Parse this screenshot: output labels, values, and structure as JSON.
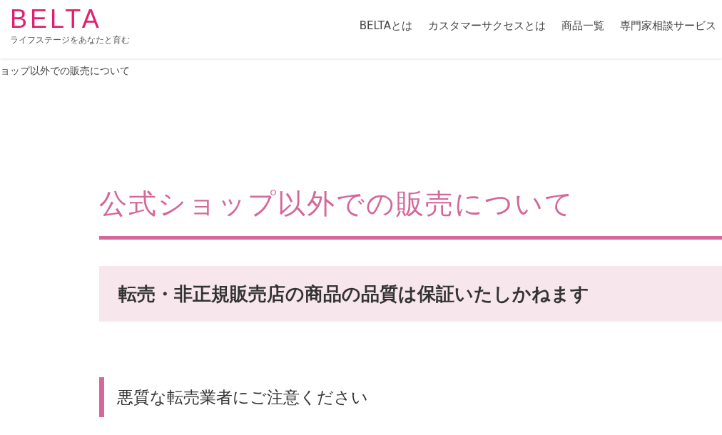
{
  "header": {
    "logo": "BELTA",
    "tagline": "ライフステージをあなたと育む",
    "nav": [
      "BELTAとは",
      "カスタマーサクセスとは",
      "商品一覧",
      "専門家相談サービス"
    ]
  },
  "breadcrumb": "ョップ以外での販売について",
  "page_title": "公式ショップ以外での販売について",
  "notice": "転売・非正規販売店の商品の品質は保証いたしかねます",
  "section_heading": "悪質な転売業者にご注意ください"
}
